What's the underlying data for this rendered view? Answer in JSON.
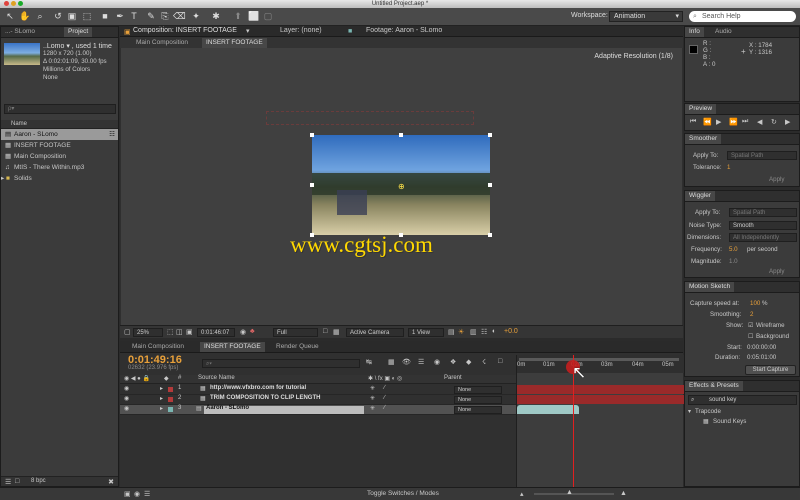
{
  "window": {
    "title": "Untitled Project.aep *"
  },
  "toolbar": {
    "workspace_label": "Workspace:",
    "workspace_value": "Animation",
    "search_placeholder": "Search Help"
  },
  "project_panel": {
    "tabs": [
      "...- SLomo",
      "Project"
    ],
    "selected_name": "..Lomo ▾ , used 1 time",
    "info_lines": [
      "1280 x 720 (1.00)",
      "Δ 0:02:01:09, 30.00 fps",
      "Millions of Colors",
      "None"
    ],
    "search_placeholder": "ρ▾",
    "name_header": "Name",
    "items": [
      {
        "name": "Aaron - SLomo",
        "selected": true
      },
      {
        "name": "INSERT FOOTAGE",
        "selected": false
      },
      {
        "name": "Main Composition",
        "selected": false
      },
      {
        "name": "MtIS - There Within.mp3",
        "selected": false
      },
      {
        "name": "Solids",
        "selected": false
      }
    ],
    "bpc_label": "8 bpc"
  },
  "viewer": {
    "tab_comp": "Composition: INSERT FOOTAGE",
    "tab_layer": "Layer: (none)",
    "tab_footage": "Footage: Aaron - SLomo",
    "sub_tabs": [
      "Main Composition",
      "INSERT FOOTAGE"
    ],
    "adaptive": "Adaptive Resolution (1/8)",
    "watermark": "www.cgtsj.com",
    "zoom": "25%",
    "timecode": "0:01:46:07",
    "resolution": "Full",
    "camera": "Active Camera",
    "views": "1 View",
    "exposure": "+0.0"
  },
  "info_panel": {
    "tabs": [
      "Info",
      "Audio"
    ],
    "r": "R :",
    "g": "G :",
    "b": "B :",
    "a": "A : 0",
    "x": "X : 1784",
    "y": "Y : 1316"
  },
  "preview_panel": {
    "title": "Preview"
  },
  "smoother_panel": {
    "title": "Smoother",
    "apply_to_label": "Apply To:",
    "apply_to_value": "Spatial Path",
    "tolerance_label": "Tolerance:",
    "tolerance_value": "1",
    "apply_button": "Apply"
  },
  "wiggler_panel": {
    "title": "Wiggler",
    "apply_to_label": "Apply To:",
    "apply_to_value": "Spatial Path",
    "noise_label": "Noise Type:",
    "noise_value": "Smooth",
    "dimensions_label": "Dimensions:",
    "dimensions_value": "All Independently",
    "frequency_label": "Frequency:",
    "frequency_value": "5.0",
    "frequency_unit": "per second",
    "magnitude_label": "Magnitude:",
    "magnitude_value": "1.0",
    "apply_button": "Apply"
  },
  "motion_sketch_panel": {
    "title": "Motion Sketch",
    "capture_label": "Capture speed at:",
    "capture_value": "100",
    "capture_unit": "%",
    "smoothing_label": "Smoothing:",
    "smoothing_value": "2",
    "show_label": "Show:",
    "wireframe": "Wireframe",
    "background": "Background",
    "start_label": "Start:",
    "start_value": "0:00:00:00",
    "duration_label": "Duration:",
    "duration_value": "0:05:01:00",
    "button": "Start Capture"
  },
  "effects_panel": {
    "title": "Effects & Presets",
    "search_value": "sound key",
    "group": "Trapcode",
    "item": "Sound Keys"
  },
  "timeline": {
    "tabs": [
      "Main Composition",
      "INSERT FOOTAGE",
      "Render Queue"
    ],
    "timecode": "0:01:49:16",
    "frames": "02632 (23.976 fps)",
    "col_source": "Source Name",
    "col_parent": "Parent",
    "ruler": [
      "0m",
      "01m",
      "02m",
      "03m",
      "04m",
      "05m"
    ],
    "layers": [
      {
        "num": "1",
        "name": "http://www.vfxbro.com for tutorial",
        "parent": "None",
        "color": "#b33a3a"
      },
      {
        "num": "2",
        "name": "TRIM COMPOSITION TO CLIP LENGTH",
        "parent": "None",
        "color": "#b33a3a"
      },
      {
        "num": "3",
        "name": "Aaron - SLomo",
        "parent": "None",
        "color": "#7ab6b2"
      }
    ],
    "toggle_label": "Toggle Switches / Modes"
  },
  "colors": {
    "accent": "#e8a03a",
    "playhead": "#e02020",
    "layer_bar": "#9a2a2a",
    "footage_bar": "#9fc9c6"
  }
}
